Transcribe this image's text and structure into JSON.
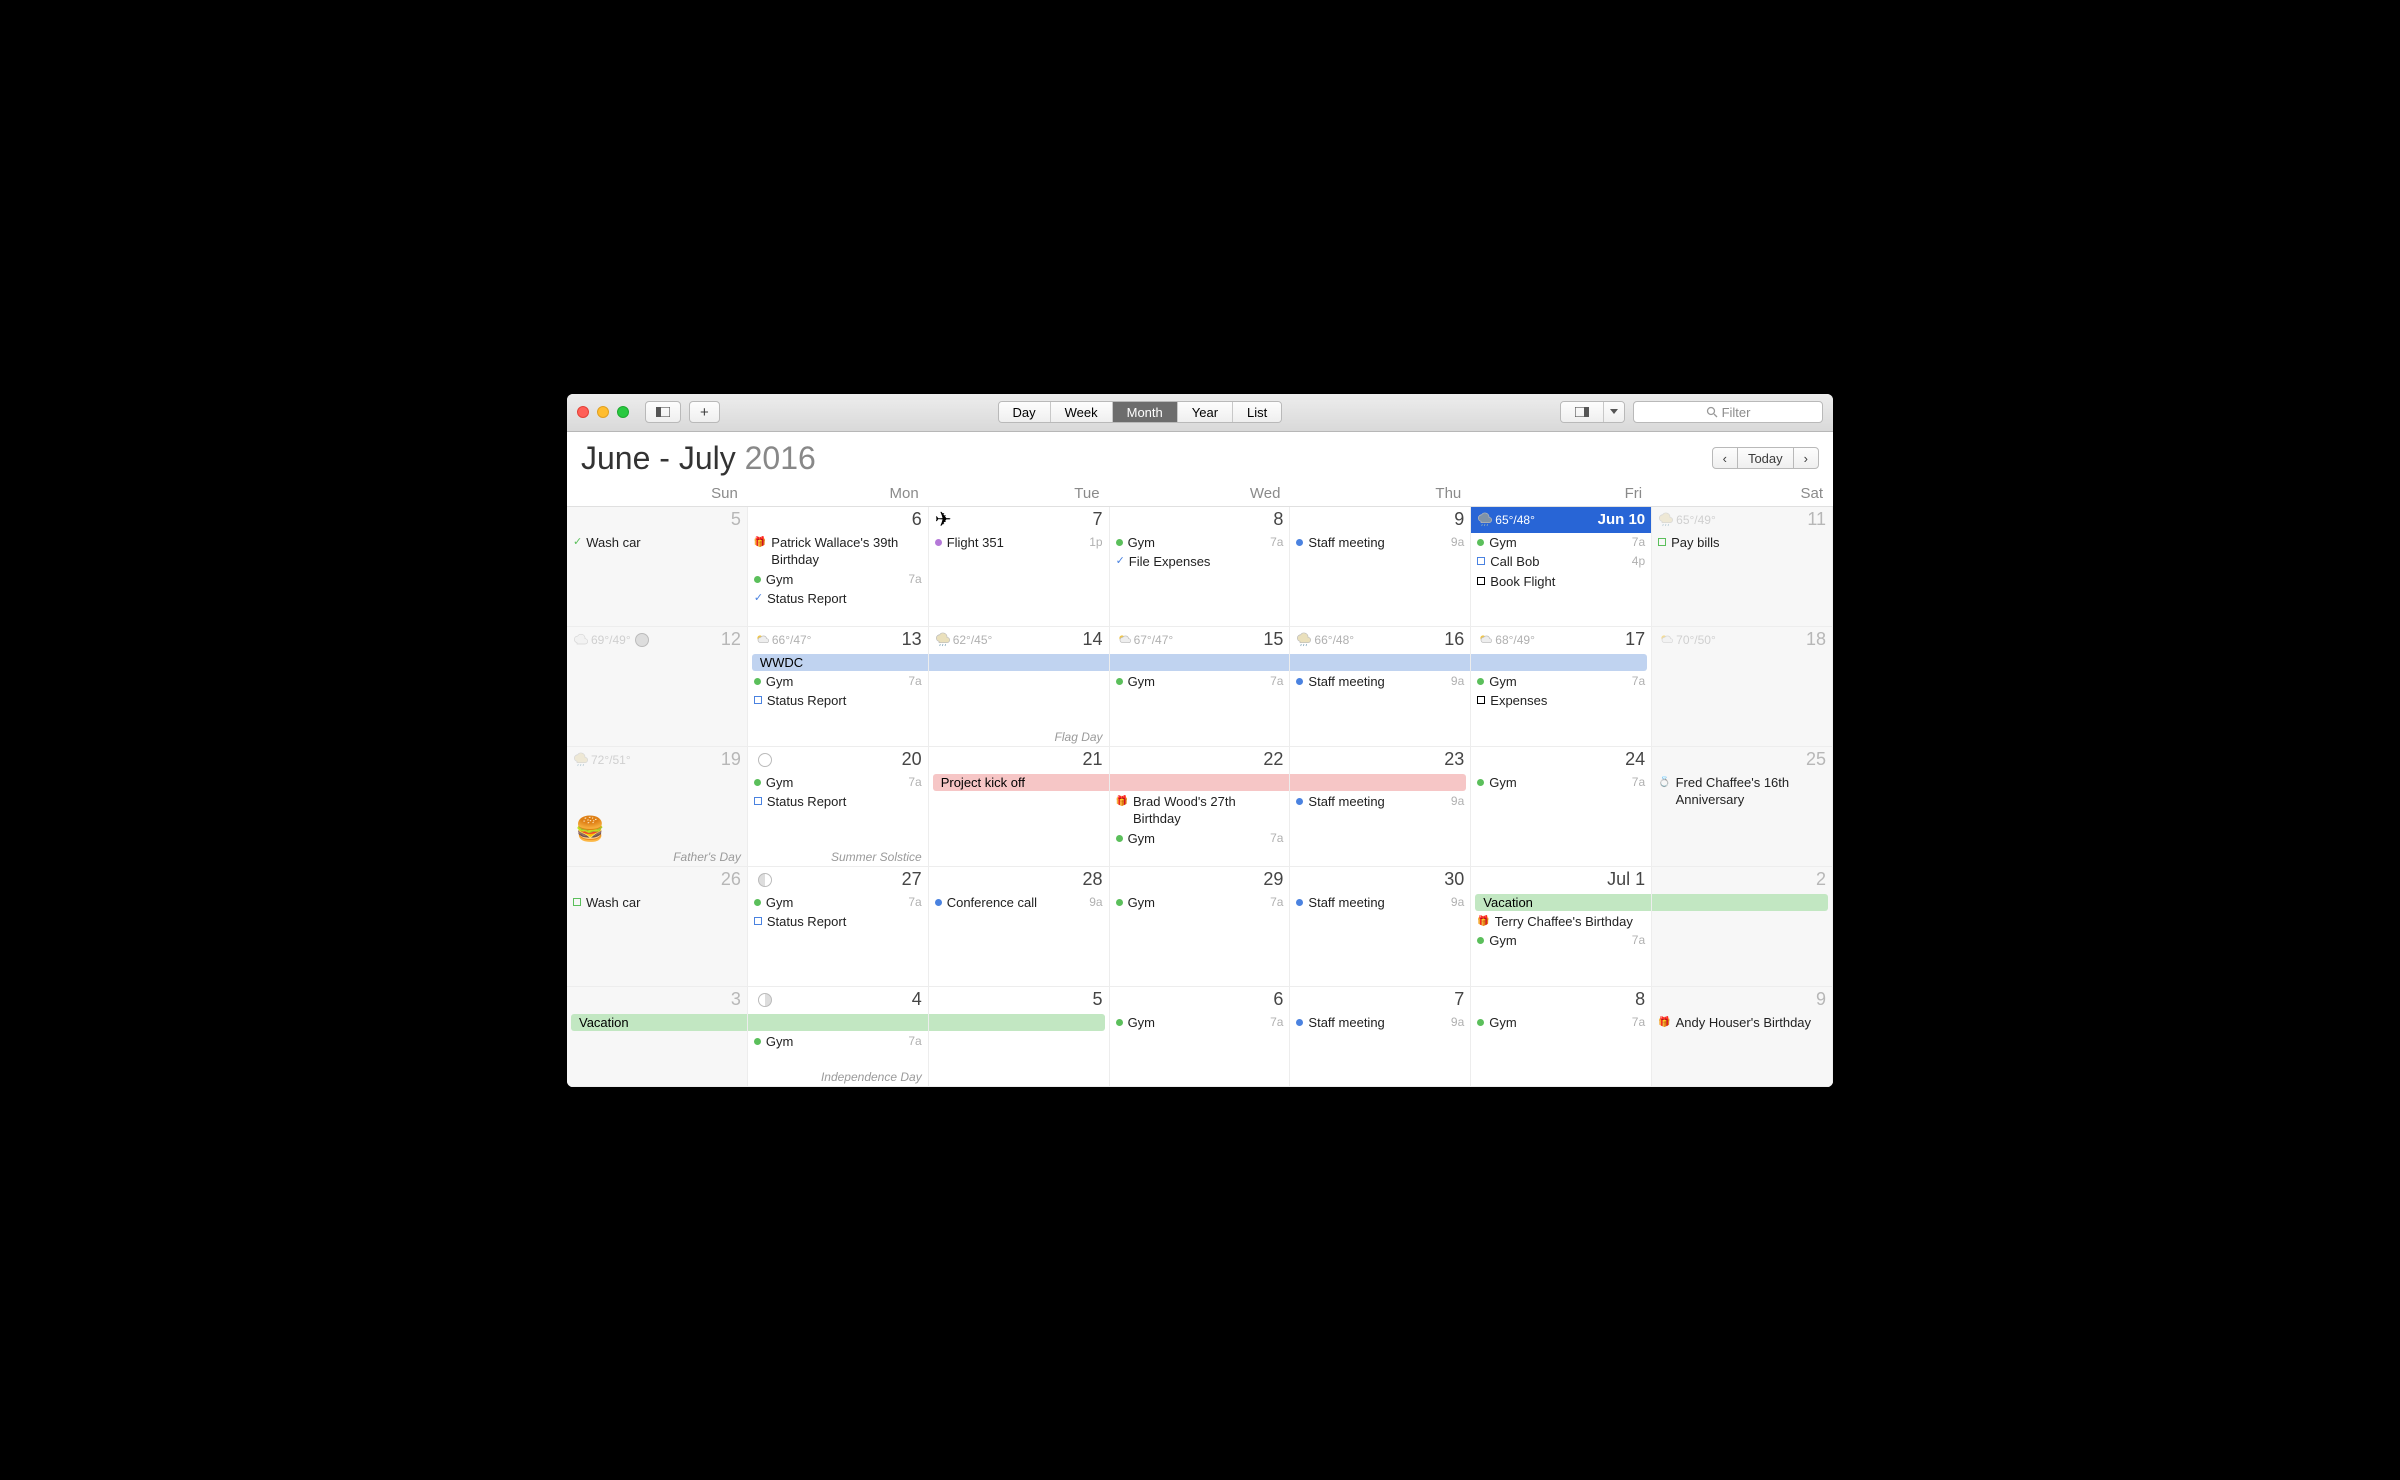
{
  "toolbar": {
    "views": [
      "Day",
      "Week",
      "Month",
      "Year",
      "List"
    ],
    "active_view": "Month",
    "today_label": "Today",
    "filter_placeholder": "Filter"
  },
  "header": {
    "title_range": "June - July",
    "year": "2016"
  },
  "dayheaders": [
    "Sun",
    "Mon",
    "Tue",
    "Wed",
    "Thu",
    "Fri",
    "Sat"
  ],
  "weeks": [
    {
      "days": [
        {
          "num": "5",
          "weekend": true,
          "dim": true,
          "events": [
            {
              "type": "check",
              "label": "Wash car"
            }
          ]
        },
        {
          "num": "6",
          "events": [
            {
              "type": "birthday",
              "label": "Patrick Wallace's 39th Birthday"
            },
            {
              "type": "dot",
              "color": "green",
              "label": "Gym",
              "time": "7a"
            },
            {
              "type": "checkblue",
              "label": "Status Report"
            }
          ]
        },
        {
          "num": "7",
          "headicon": "plane",
          "events": [
            {
              "type": "dot",
              "color": "purple",
              "label": "Flight 351",
              "time": "1p"
            }
          ]
        },
        {
          "num": "8",
          "events": [
            {
              "type": "dot",
              "color": "green",
              "label": "Gym",
              "time": "7a"
            },
            {
              "type": "checkblue",
              "label": "File Expenses"
            }
          ]
        },
        {
          "num": "9",
          "events": [
            {
              "type": "dot",
              "color": "blue",
              "label": "Staff meeting",
              "time": "9a"
            }
          ]
        },
        {
          "num": "Jun 10",
          "today": true,
          "weather": {
            "text": "65°/48°",
            "icon": "rain"
          },
          "events": [
            {
              "type": "dot",
              "color": "green",
              "label": "Gym",
              "time": "7a"
            },
            {
              "type": "sq",
              "color": "blue",
              "label": "Call Bob",
              "time": "4p"
            },
            {
              "type": "sq",
              "color": "red",
              "label": "Book Flight"
            }
          ]
        },
        {
          "num": "11",
          "weekend": true,
          "dim": true,
          "weather": {
            "text": "65°/49°",
            "icon": "rain",
            "dim": true
          },
          "events": [
            {
              "type": "sq",
              "color": "green",
              "label": "Pay bills"
            }
          ]
        }
      ]
    },
    {
      "days": [
        {
          "num": "12",
          "weekend": true,
          "dim": true,
          "weather": {
            "text": "69°/49°",
            "icon": "cloud",
            "dim": true
          },
          "moon": "full"
        },
        {
          "num": "13",
          "weather": {
            "text": "66°/47°",
            "icon": "suncloud"
          },
          "events": [
            {
              "type": "bar",
              "color": "blue",
              "label": "WWDC",
              "span": "start"
            },
            {
              "type": "dot",
              "color": "green",
              "label": "Gym",
              "time": "7a"
            },
            {
              "type": "sq",
              "color": "blue",
              "label": "Status Report"
            }
          ]
        },
        {
          "num": "14",
          "weather": {
            "text": "62°/45°",
            "icon": "rain"
          },
          "holiday": "Flag Day",
          "events": [
            {
              "type": "bar",
              "color": "blue",
              "span": "mid"
            }
          ]
        },
        {
          "num": "15",
          "weather": {
            "text": "67°/47°",
            "icon": "suncloud"
          },
          "events": [
            {
              "type": "bar",
              "color": "blue",
              "span": "mid"
            },
            {
              "type": "dot",
              "color": "green",
              "label": "Gym",
              "time": "7a"
            }
          ]
        },
        {
          "num": "16",
          "weather": {
            "text": "66°/48°",
            "icon": "rain"
          },
          "events": [
            {
              "type": "bar",
              "color": "blue",
              "span": "mid"
            },
            {
              "type": "dot",
              "color": "blue",
              "label": "Staff meeting",
              "time": "9a"
            }
          ]
        },
        {
          "num": "17",
          "weather": {
            "text": "68°/49°",
            "icon": "suncloud"
          },
          "events": [
            {
              "type": "bar",
              "color": "blue",
              "span": "end"
            },
            {
              "type": "dot",
              "color": "green",
              "label": "Gym",
              "time": "7a"
            },
            {
              "type": "sq",
              "color": "red",
              "label": "Expenses"
            }
          ]
        },
        {
          "num": "18",
          "weekend": true,
          "dim": true,
          "weather": {
            "text": "70°/50°",
            "icon": "suncloud",
            "dim": true
          }
        }
      ]
    },
    {
      "days": [
        {
          "num": "19",
          "weekend": true,
          "dim": true,
          "weather": {
            "text": "72°/51°",
            "icon": "rain",
            "dim": true
          },
          "holiday": "Father's Day",
          "burger": true
        },
        {
          "num": "20",
          "moon": "new",
          "holiday": "Summer Solstice",
          "events": [
            {
              "type": "dot",
              "color": "green",
              "label": "Gym",
              "time": "7a"
            },
            {
              "type": "sq",
              "color": "blue",
              "label": "Status Report"
            }
          ]
        },
        {
          "num": "21",
          "events": [
            {
              "type": "bar",
              "color": "pink",
              "label": "Project kick off",
              "span": "start"
            }
          ]
        },
        {
          "num": "22",
          "events": [
            {
              "type": "bar",
              "color": "pink",
              "span": "mid"
            },
            {
              "type": "birthday",
              "label": "Brad Wood's 27th Birthday"
            },
            {
              "type": "dot",
              "color": "green",
              "label": "Gym",
              "time": "7a"
            }
          ]
        },
        {
          "num": "23",
          "events": [
            {
              "type": "bar",
              "color": "pink",
              "span": "end"
            },
            {
              "type": "dot",
              "color": "blue",
              "label": "Staff meeting",
              "time": "9a"
            }
          ]
        },
        {
          "num": "24",
          "events": [
            {
              "type": "dot",
              "color": "green",
              "label": "Gym",
              "time": "7a"
            }
          ]
        },
        {
          "num": "25",
          "weekend": true,
          "dim": true,
          "events": [
            {
              "type": "anniv",
              "label": "Fred Chaffee's 16th Anniversary"
            }
          ]
        }
      ]
    },
    {
      "days": [
        {
          "num": "26",
          "weekend": true,
          "dim": true,
          "events": [
            {
              "type": "sq",
              "color": "green",
              "label": "Wash car"
            }
          ]
        },
        {
          "num": "27",
          "moon": "half",
          "events": [
            {
              "type": "dot",
              "color": "green",
              "label": "Gym",
              "time": "7a"
            },
            {
              "type": "sq",
              "color": "blue",
              "label": "Status Report"
            }
          ]
        },
        {
          "num": "28",
          "events": [
            {
              "type": "dot",
              "color": "blue",
              "label": "Conference call",
              "time": "9a"
            }
          ]
        },
        {
          "num": "29",
          "events": [
            {
              "type": "dot",
              "color": "green",
              "label": "Gym",
              "time": "7a"
            }
          ]
        },
        {
          "num": "30",
          "events": [
            {
              "type": "dot",
              "color": "blue",
              "label": "Staff meeting",
              "time": "9a"
            }
          ]
        },
        {
          "num": "Jul 1",
          "events": [
            {
              "type": "bar",
              "color": "green",
              "label": "Vacation",
              "span": "start"
            },
            {
              "type": "birthday",
              "label": "Terry Chaffee's Birthday"
            },
            {
              "type": "dot",
              "color": "green",
              "label": "Gym",
              "time": "7a"
            }
          ]
        },
        {
          "num": "2",
          "weekend": true,
          "dim": true,
          "events": [
            {
              "type": "bar",
              "color": "green",
              "span": "end"
            }
          ]
        }
      ]
    },
    {
      "short": true,
      "days": [
        {
          "num": "3",
          "weekend": true,
          "dim": true,
          "events": [
            {
              "type": "bar",
              "color": "green",
              "label": "Vacation",
              "span": "start"
            }
          ]
        },
        {
          "num": "4",
          "moon": "wax",
          "holiday": "Independence Day",
          "events": [
            {
              "type": "bar",
              "color": "green",
              "span": "mid"
            },
            {
              "type": "dot",
              "color": "green",
              "label": "Gym",
              "time": "7a"
            }
          ]
        },
        {
          "num": "5",
          "events": [
            {
              "type": "bar",
              "color": "green",
              "span": "end"
            }
          ]
        },
        {
          "num": "6",
          "events": [
            {
              "type": "dot",
              "color": "green",
              "label": "Gym",
              "time": "7a"
            }
          ]
        },
        {
          "num": "7",
          "events": [
            {
              "type": "dot",
              "color": "blue",
              "label": "Staff meeting",
              "time": "9a"
            }
          ]
        },
        {
          "num": "8",
          "events": [
            {
              "type": "dot",
              "color": "green",
              "label": "Gym",
              "time": "7a"
            }
          ]
        },
        {
          "num": "9",
          "weekend": true,
          "dim": true,
          "events": [
            {
              "type": "birthday",
              "label": "Andy Houser's Birthday"
            }
          ]
        }
      ]
    }
  ]
}
